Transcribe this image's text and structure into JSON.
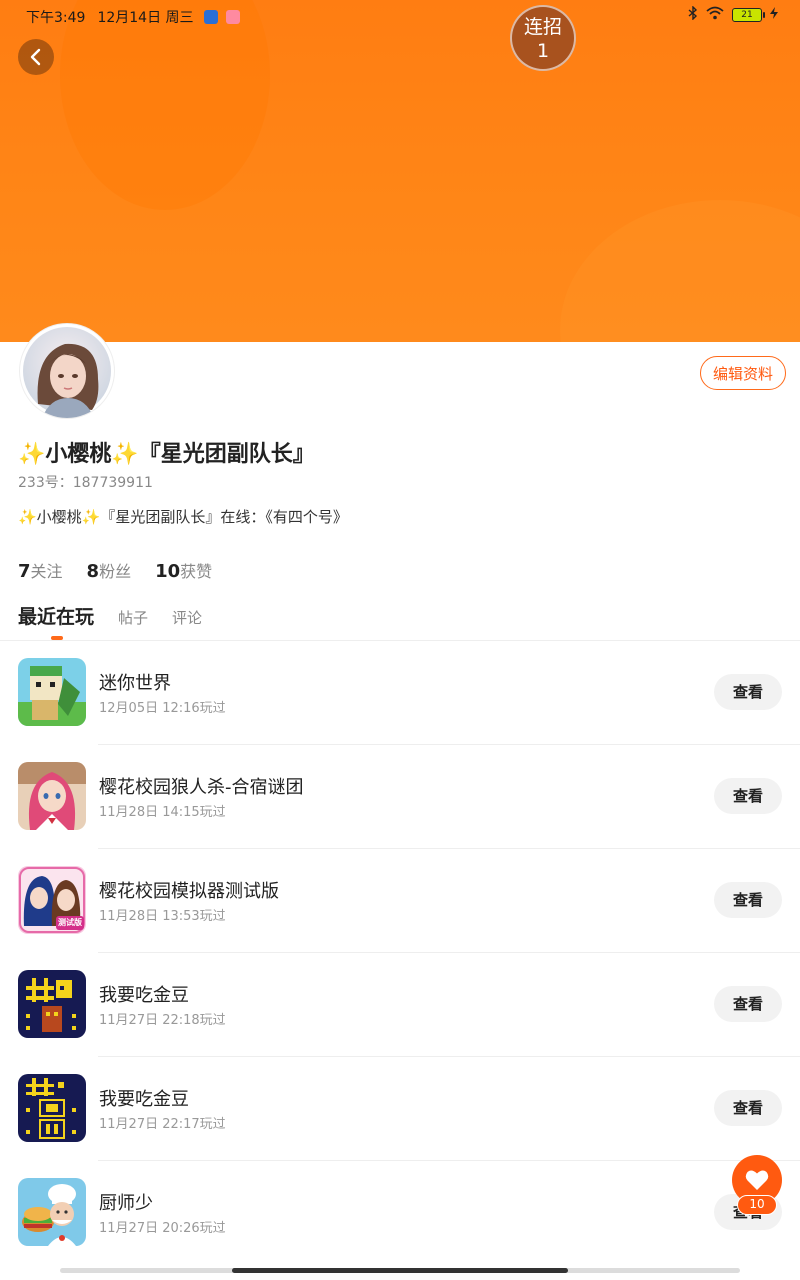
{
  "status_bar": {
    "time": "下午3:49",
    "date": "12月14日 周三",
    "battery": "21"
  },
  "combo": {
    "label": "连招",
    "count": "1"
  },
  "profile": {
    "nickname": "✨小樱桃✨『星光团副队长』",
    "uid": "233号：187739911",
    "bio": "✨小樱桃✨『星光团副队长』在线：《有四个号》",
    "edit_label": "编辑资料"
  },
  "stats": [
    {
      "count": "7",
      "label": "关注"
    },
    {
      "count": "8",
      "label": "粉丝"
    },
    {
      "count": "10",
      "label": "获赞"
    }
  ],
  "tabs": [
    "最近在玩",
    "帖子",
    "评论"
  ],
  "games": [
    {
      "name": "迷你世界",
      "time": "12月05日 12:16玩过",
      "button": "查看",
      "icon": "mini-world-icon"
    },
    {
      "name": "樱花校园狼人杀-合宿谜团",
      "time": "11月28日 14:15玩过",
      "button": "查看",
      "icon": "sakura-werewolf-icon"
    },
    {
      "name": "樱花校园模拟器测试版",
      "time": "11月28日 13:53玩过",
      "button": "查看",
      "icon": "sakura-simulator-icon",
      "badge": "测试版"
    },
    {
      "name": "我要吃金豆",
      "time": "11月27日 22:18玩过",
      "button": "查看",
      "icon": "gold-bean-icon"
    },
    {
      "name": "我要吃金豆",
      "time": "11月27日 22:17玩过",
      "button": "查看",
      "icon": "gold-bean-wall-icon"
    },
    {
      "name": "厨师少",
      "time": "11月27日 20:26玩过",
      "button": "查看",
      "icon": "chef-icon"
    }
  ],
  "like": {
    "count": "10"
  },
  "colors": {
    "accent": "#ff5a10",
    "banner": "#ff8617"
  }
}
